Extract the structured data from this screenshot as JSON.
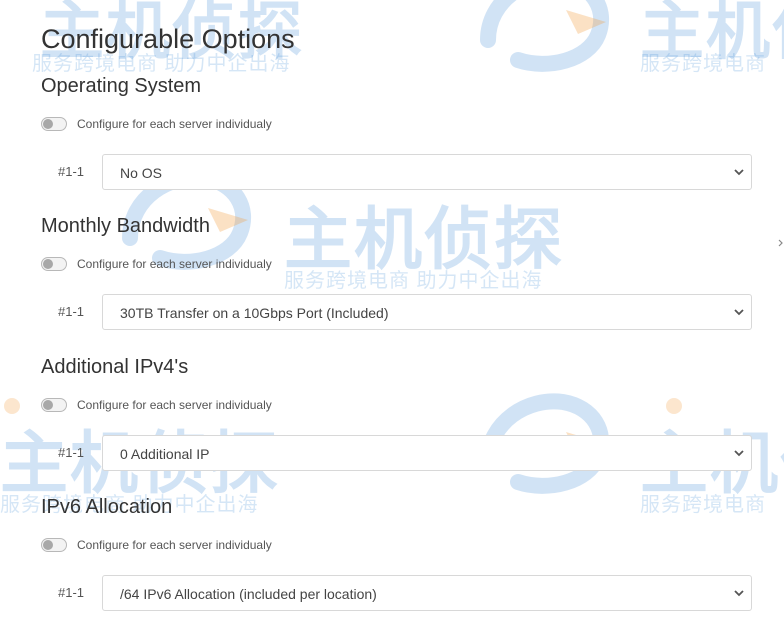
{
  "page": {
    "title": "Configurable Options"
  },
  "watermark": {
    "brand": "主机侦探",
    "slogan": "服务跨境电商 助力中企出海",
    "slogan_short": "服务跨境电商"
  },
  "sections": [
    {
      "title": "Operating System",
      "toggle_label": "Configure for each server individualy",
      "toggle_on": false,
      "item_id": "#1-1",
      "selected": "No OS"
    },
    {
      "title": "Monthly Bandwidth",
      "toggle_label": "Configure for each server individualy",
      "toggle_on": false,
      "item_id": "#1-1",
      "selected": "30TB Transfer on a 10Gbps Port (Included)"
    },
    {
      "title": "Additional IPv4's",
      "toggle_label": "Configure for each server individualy",
      "toggle_on": false,
      "item_id": "#1-1",
      "selected": "0 Additional IP"
    },
    {
      "title": "IPv6 Allocation",
      "toggle_label": "Configure for each server individualy",
      "toggle_on": false,
      "item_id": "#1-1",
      "selected": "/64 IPv6 Allocation (included per location)"
    }
  ],
  "colors": {
    "watermark": "#2f80d0",
    "watermark_accent": "#f29a3c",
    "text": "#333333",
    "border": "#d8d8d8"
  }
}
